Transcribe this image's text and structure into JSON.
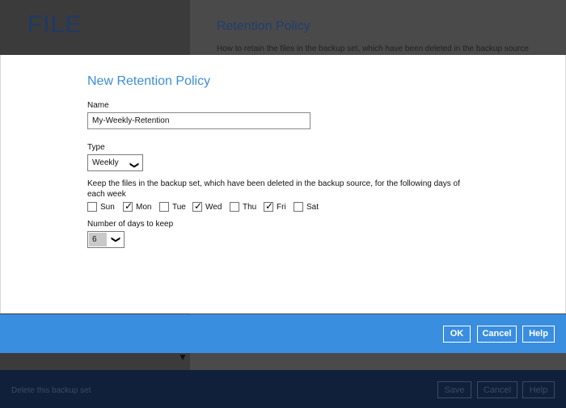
{
  "background": {
    "logo": "FILE",
    "heading": "Retention Policy",
    "subheading": "How to retain the files in the backup set, which have been deleted in the backup source",
    "footer_link": "Delete this backup set",
    "buttons": {
      "save": "Save",
      "cancel": "Cancel",
      "help": "Help"
    }
  },
  "dialog": {
    "title": "New Retention Policy",
    "name_label": "Name",
    "name_value": "My-Weekly-Retention",
    "type_label": "Type",
    "type_value": "Weekly",
    "description": "Keep the files in the backup set, which have been deleted in the backup source, for the following days of each week",
    "days": [
      {
        "label": "Sun",
        "checked": false
      },
      {
        "label": "Mon",
        "checked": true
      },
      {
        "label": "Tue",
        "checked": false
      },
      {
        "label": "Wed",
        "checked": true
      },
      {
        "label": "Thu",
        "checked": false
      },
      {
        "label": "Fri",
        "checked": true
      },
      {
        "label": "Sat",
        "checked": false
      }
    ],
    "days_to_keep_label": "Number of days to keep",
    "days_to_keep_value": "6",
    "buttons": {
      "ok": "OK",
      "cancel": "Cancel",
      "help": "Help"
    }
  },
  "colors": {
    "accent": "#3a8ee0",
    "title": "#3c8fd6",
    "footer_dark": "#10203a"
  }
}
